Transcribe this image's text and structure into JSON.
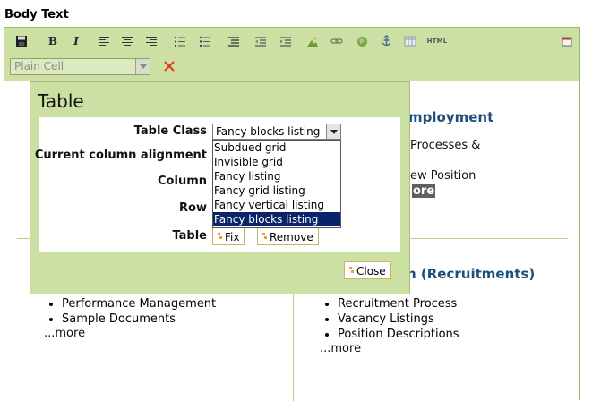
{
  "page": {
    "label": "Body Text"
  },
  "toolbar": {
    "html_label": "HTML",
    "style_select_value": "Plain Cell",
    "icons": [
      "save-icon",
      "bold-icon",
      "italic-icon",
      "align-left-icon",
      "align-center-icon",
      "align-right-icon",
      "ordered-list-icon",
      "unordered-list-icon",
      "block-indent-icon",
      "outdent-icon",
      "indent-icon",
      "insert-image-icon",
      "insert-link-icon",
      "insert-globe-link-icon",
      "insert-anchor-icon",
      "insert-table-icon",
      "html-source-icon",
      "maximize-icon",
      "clear-format-icon"
    ],
    "bold_label": "B",
    "italic_label": "I"
  },
  "content": {
    "heading_top": "mployment",
    "line_processes": "Processes &",
    "line_new_position": "ew Position",
    "more_dark": "ore",
    "heading_recruitments": "n (Recruitments)",
    "left_list": [
      "Performance Management",
      "Sample Documents"
    ],
    "left_more": "...more",
    "right_list": [
      "Recruitment Process",
      "Vacancy Listings",
      "Position Descriptions"
    ],
    "right_more": "...more"
  },
  "dialog": {
    "title": "Table",
    "labels": {
      "table_class": "Table Class",
      "column_alignment": "Current column alignment",
      "column": "Column",
      "row": "Row",
      "table": "Table"
    },
    "table_class_value": "Fancy blocks listing",
    "table_class_options": [
      "Subdued grid",
      "Invisible grid",
      "Fancy listing",
      "Fancy grid listing",
      "Fancy vertical listing",
      "Fancy blocks listing"
    ],
    "selected_option_index": 5,
    "fix_label": "Fix",
    "remove_label": "Remove",
    "close_label": "Close"
  },
  "colors": {
    "toolbar_bg": "#cde0a4",
    "heading_blue": "#1d4f7a",
    "selected_option_bg": "#0a246a",
    "clear_x": "#e03a1e"
  }
}
